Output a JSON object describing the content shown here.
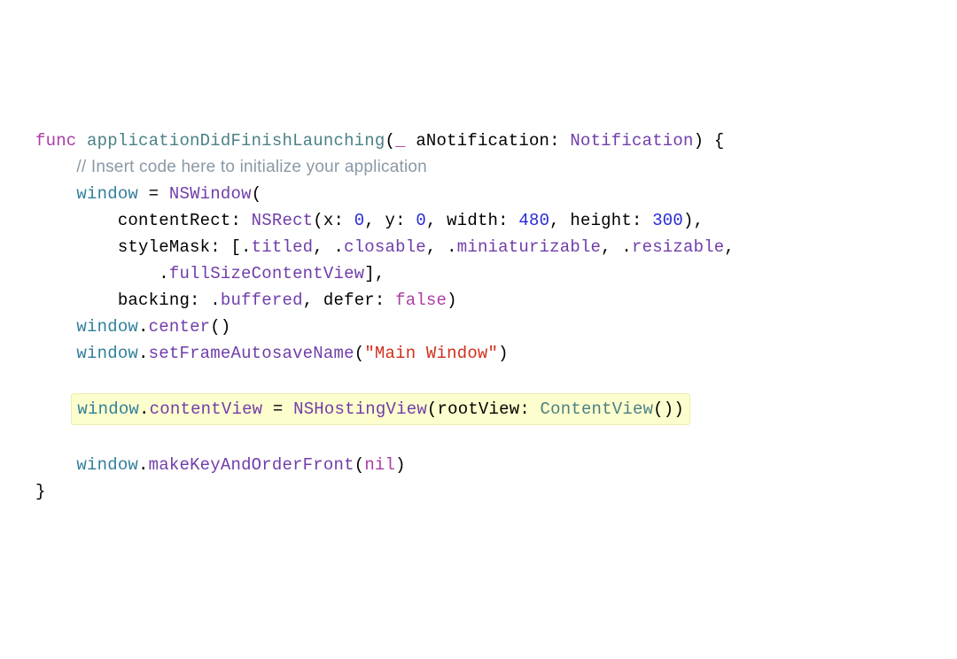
{
  "code": {
    "kw_func": "func",
    "fn_name": "applicationDidFinishLaunching",
    "underscore": "_",
    "param_name": "aNotification",
    "type_notification": "Notification",
    "openBraceLine_tail": ") {",
    "comment": "// Insert code here to initialize your application",
    "window": "window",
    "eq": " = ",
    "type_nswindow": "NSWindow",
    "lparen": "(",
    "contentRect_label": "contentRect: ",
    "type_nsrect": "NSRect",
    "nsrect_args_prefix": "(x: ",
    "num_0a": "0",
    "nsrect_y": ", y: ",
    "num_0b": "0",
    "nsrect_w": ", width: ",
    "num_480": "480",
    "nsrect_h": ", height: ",
    "num_300": "300",
    "nsrect_close": "),",
    "styleMask_label": "styleMask: [.",
    "titled": "titled",
    "closable": "closable",
    "miniaturizable": "miniaturizable",
    "resizable": "resizable",
    "fullSize": "fullSizeContentView",
    "styleMask_close": "],",
    "backing_label": "backing: .",
    "buffered": "buffered",
    "defer_label": ", defer: ",
    "kw_false": "false",
    "rparen": ")",
    "dot": ".",
    "fn_center": "center",
    "empty_parens": "()",
    "fn_setFrameAutosaveName": "setFrameAutosaveName",
    "str_mainwindow": "\"Main Window\"",
    "prop_contentView": "contentView",
    "type_nshostingview": "NSHostingView",
    "rootView_label": "(rootView: ",
    "type_contentview": "ContentView",
    "close_two": "())",
    "fn_makeKeyAndOrderFront": "makeKeyAndOrderFront",
    "kw_nil": "nil",
    "close_brace": "}"
  }
}
